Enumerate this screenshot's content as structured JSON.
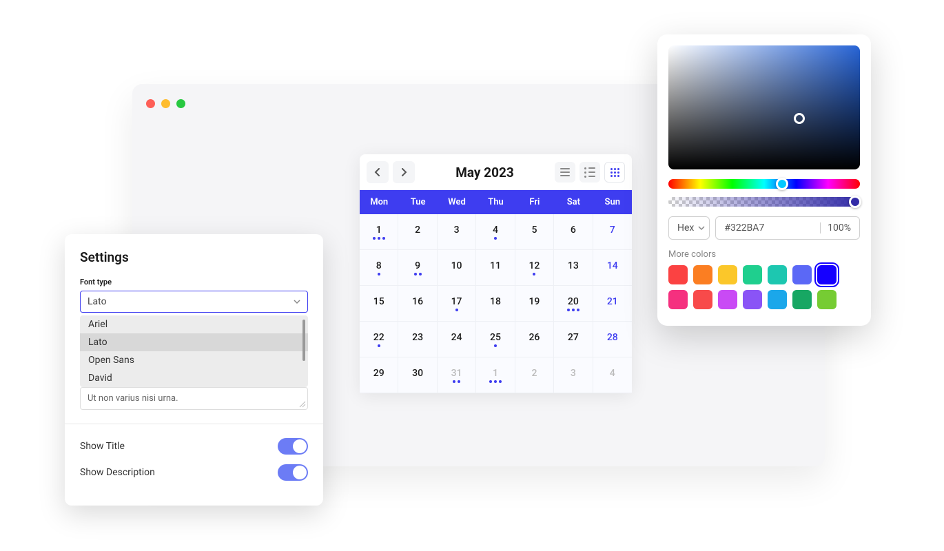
{
  "calendar": {
    "title": "May 2023",
    "dayNames": [
      "Mon",
      "Tue",
      "Wed",
      "Thu",
      "Fri",
      "Sat",
      "Sun"
    ],
    "cells": [
      {
        "n": "1",
        "dots": 3
      },
      {
        "n": "2",
        "dots": 0
      },
      {
        "n": "3",
        "dots": 0
      },
      {
        "n": "4",
        "dots": 1
      },
      {
        "n": "5",
        "dots": 0
      },
      {
        "n": "6",
        "dots": 0
      },
      {
        "n": "7",
        "dots": 0,
        "weekend": true
      },
      {
        "n": "8",
        "dots": 1
      },
      {
        "n": "9",
        "dots": 2
      },
      {
        "n": "10",
        "dots": 0
      },
      {
        "n": "11",
        "dots": 0
      },
      {
        "n": "12",
        "dots": 1
      },
      {
        "n": "13",
        "dots": 0
      },
      {
        "n": "14",
        "dots": 0,
        "weekend": true
      },
      {
        "n": "15",
        "dots": 0
      },
      {
        "n": "16",
        "dots": 0
      },
      {
        "n": "17",
        "dots": 1
      },
      {
        "n": "18",
        "dots": 0
      },
      {
        "n": "19",
        "dots": 0
      },
      {
        "n": "20",
        "dots": 3
      },
      {
        "n": "21",
        "dots": 0,
        "weekend": true
      },
      {
        "n": "22",
        "dots": 1
      },
      {
        "n": "23",
        "dots": 0
      },
      {
        "n": "24",
        "dots": 0
      },
      {
        "n": "25",
        "dots": 1
      },
      {
        "n": "26",
        "dots": 0
      },
      {
        "n": "27",
        "dots": 0
      },
      {
        "n": "28",
        "dots": 0,
        "weekend": true
      },
      {
        "n": "29",
        "dots": 0
      },
      {
        "n": "30",
        "dots": 0
      },
      {
        "n": "31",
        "dots": 2,
        "muted": true
      },
      {
        "n": "1",
        "dots": 3,
        "muted": true
      },
      {
        "n": "2",
        "dots": 0,
        "muted": true
      },
      {
        "n": "3",
        "dots": 0,
        "muted": true
      },
      {
        "n": "4",
        "dots": 0,
        "muted": true
      }
    ]
  },
  "settings": {
    "title": "Settings",
    "fontTypeLabel": "Font type",
    "fontSelected": "Lato",
    "fontOptions": [
      "Ariel",
      "Lato",
      "Open Sans",
      "David"
    ],
    "textareaValue": "Ut non varius nisi urna.",
    "showTitleLabel": "Show Title",
    "showDescriptionLabel": "Show Description"
  },
  "colorPicker": {
    "formatLabel": "Hex",
    "hexValue": "#322BA7",
    "opacity": "100%",
    "moreColorsLabel": "More colors",
    "swatchesRow1": [
      "#fb4242",
      "#fb7e22",
      "#fbc72a",
      "#1fcf8e",
      "#1dc7b0",
      "#5b68f6",
      "#1500ff"
    ],
    "swatchesRow2": [
      "#f5307f",
      "#f84a4a",
      "#c94af5",
      "#8a54f6",
      "#1ba7ea",
      "#17a763",
      "#76cc33"
    ],
    "selectedSwatch": "#1500ff"
  }
}
